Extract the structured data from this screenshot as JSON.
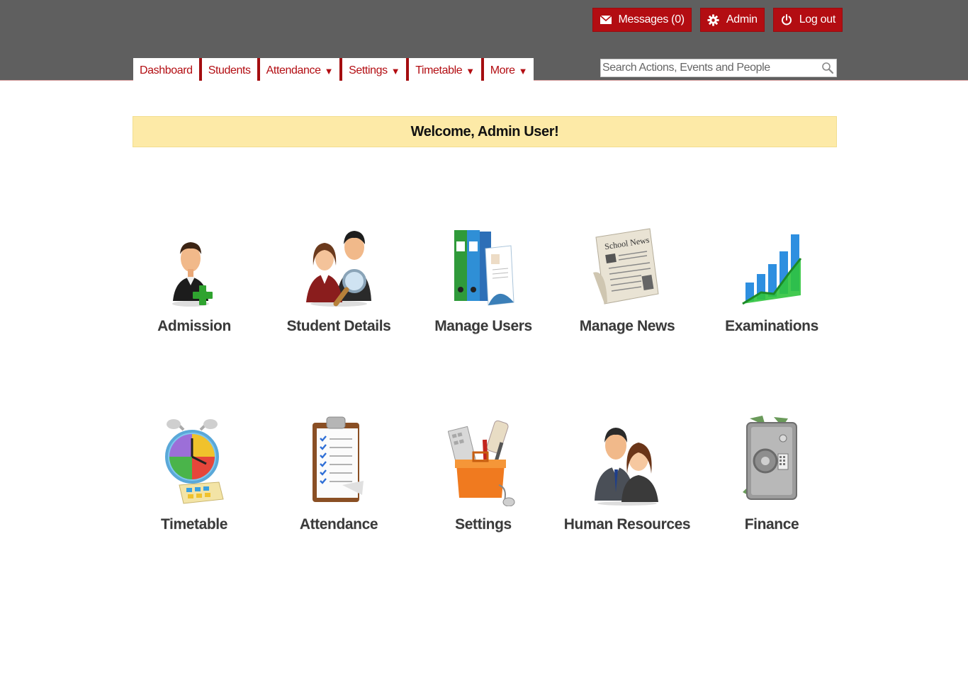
{
  "header": {
    "messages_label": "Messages (0)",
    "admin_label": "Admin",
    "logout_label": "Log out"
  },
  "nav": {
    "tabs": [
      {
        "label": "Dashboard",
        "dropdown": false
      },
      {
        "label": "Students",
        "dropdown": false
      },
      {
        "label": "Attendance",
        "dropdown": true
      },
      {
        "label": "Settings",
        "dropdown": true
      },
      {
        "label": "Timetable",
        "dropdown": true
      },
      {
        "label": "More",
        "dropdown": true
      }
    ],
    "caret": "▼"
  },
  "search": {
    "placeholder": "Search Actions, Events and People",
    "value": ""
  },
  "welcome": {
    "text": "Welcome, Admin User!"
  },
  "tiles": [
    {
      "label": "Admission",
      "icon": "admission-icon"
    },
    {
      "label": "Student Details",
      "icon": "student-details-icon"
    },
    {
      "label": "Manage Users",
      "icon": "manage-users-icon"
    },
    {
      "label": "Manage News",
      "icon": "manage-news-icon"
    },
    {
      "label": "Examinations",
      "icon": "examinations-icon"
    },
    {
      "label": "Timetable",
      "icon": "timetable-icon"
    },
    {
      "label": "Attendance",
      "icon": "attendance-icon"
    },
    {
      "label": "Settings",
      "icon": "settings-icon"
    },
    {
      "label": "Human Resources",
      "icon": "human-resources-icon"
    },
    {
      "label": "Finance",
      "icon": "finance-icon"
    }
  ],
  "news_icon_text": "School News",
  "colors": {
    "topbar": "#5f5f5f",
    "accent": "#b30d12",
    "welcome_bg": "#fdeaa7"
  }
}
